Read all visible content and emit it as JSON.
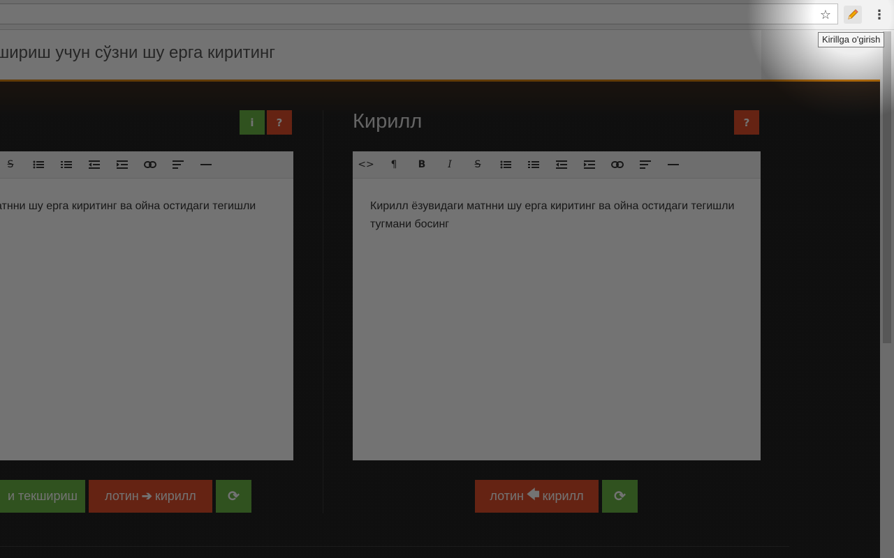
{
  "browser": {
    "star_glyph": "☆",
    "extension_glyph": "✏",
    "menu_glyph": "⋮",
    "tooltip": "Kirillga o'girish"
  },
  "page": {
    "title": "шириш учун сўзни шу ерга киритинг"
  },
  "left_panel": {
    "info_label": "i",
    "help_label": "?",
    "toolbar": [
      "strikethrough-icon",
      "bullet-list-icon",
      "numbered-list-icon",
      "outdent-icon",
      "indent-icon",
      "link-icon",
      "align-left-icon",
      "horizontal-rule-icon"
    ],
    "text": "атнни шу ерга киритинг ва ойна остидаги тегишли",
    "check_button": "и текшириш",
    "convert_button_left": "лотин",
    "convert_button_right": "кирилл",
    "refresh_icon": "refresh-icon"
  },
  "right_panel": {
    "title": "Кирилл",
    "help_label": "?",
    "toolbar": [
      "code-icon",
      "paragraph-icon",
      "bold-icon",
      "italic-icon",
      "strikethrough-icon",
      "bullet-list-icon",
      "numbered-list-icon",
      "outdent-icon",
      "indent-icon",
      "link-icon",
      "align-left-icon",
      "horizontal-rule-icon"
    ],
    "text": "Кирилл ёзувидаги матнни шу ерга киритинг ва ойна остидаги тегишли тугмани босинг",
    "convert_button_left": "лотин",
    "convert_button_right": "кирилл",
    "refresh_icon": "refresh-icon"
  },
  "colors": {
    "green": "#6bb644",
    "red": "#e04e2a",
    "accent_line": "#d9830f"
  }
}
